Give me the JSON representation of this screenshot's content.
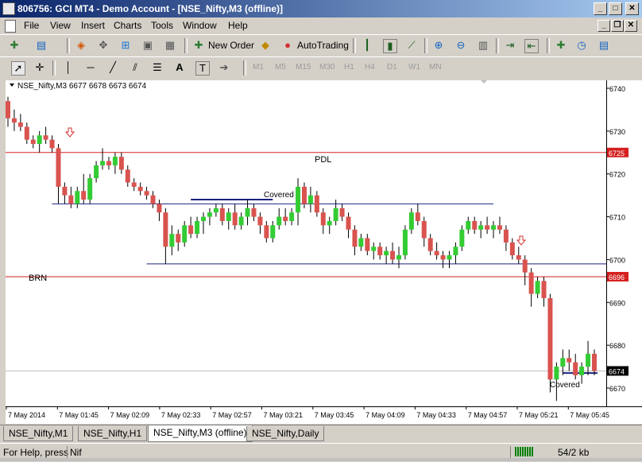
{
  "window": {
    "title": "806756: GCI MT4 - Demo Account - [NSE_Nifty,M3 (offline)]",
    "min_glyph": "_",
    "max_glyph": "□",
    "close_glyph": "✕",
    "restore_glyph": "❐"
  },
  "menu": {
    "items": [
      "File",
      "View",
      "Insert",
      "Charts",
      "Tools",
      "Window",
      "Help"
    ]
  },
  "toolbar": {
    "new_order_label": "New Order",
    "autotrading_label": "AutoTrading",
    "drawing_text_tool": "A",
    "timeframes": [
      "M1",
      "M5",
      "M15",
      "M30",
      "H1",
      "H4",
      "D1",
      "W1",
      "MN"
    ]
  },
  "chart": {
    "header": "NSE_Nifty,M3  6677 6678 6673 6674",
    "bg_color": "#ffffff",
    "bull_color": "#33cc33",
    "bear_color": "#d9534f",
    "wick_color": "#000000",
    "hline_red": "#d62020",
    "hline_blue": "#1a237e",
    "price_axis": {
      "ticks": [
        "6740",
        "6730",
        "6720",
        "6710",
        "6700",
        "6690",
        "6680",
        "6670"
      ],
      "tick_values": [
        6740,
        6730,
        6720,
        6710,
        6700,
        6690,
        6680,
        6670
      ],
      "tags": [
        {
          "value": 6725,
          "label": "6725",
          "bg": "#d62020",
          "fg": "#ffffff"
        },
        {
          "value": 6696,
          "label": "6696",
          "bg": "#d62020",
          "fg": "#ffffff"
        },
        {
          "value": 6674,
          "label": "6674",
          "bg": "#000000",
          "fg": "#ffffff"
        }
      ],
      "min": 6665,
      "max": 6742
    },
    "time_axis": {
      "labels": [
        "7 May 2014",
        "7 May 01:45",
        "7 May 02:09",
        "7 May 02:33",
        "7 May 02:57",
        "7 May 03:21",
        "7 May 03:45",
        "7 May 04:09",
        "7 May 04:33",
        "7 May 04:57",
        "7 May 05:21",
        "7 May 05:45"
      ]
    },
    "annotations": {
      "pdl": "PDL",
      "brn": "BRN",
      "covered_1": "Covered",
      "covered_2": "Covered"
    },
    "levels": {
      "pdl": 6725,
      "brn": 6696,
      "support_upper": 6713,
      "support_lower": 6699,
      "covered_1": 6714,
      "covered_2": 6673.5,
      "last_price": 6674
    },
    "candles": [
      [
        6737,
        6738,
        6731,
        6733
      ],
      [
        6733,
        6735,
        6730,
        6732
      ],
      [
        6732,
        6734,
        6730,
        6731
      ],
      [
        6731,
        6732,
        6727,
        6728
      ],
      [
        6728,
        6729,
        6726,
        6727
      ],
      [
        6727,
        6730,
        6725,
        6729
      ],
      [
        6729,
        6731,
        6727,
        6728
      ],
      [
        6728,
        6729,
        6725,
        6726
      ],
      [
        6726,
        6727,
        6713,
        6717
      ],
      [
        6717,
        6718,
        6713,
        6715
      ],
      [
        6715,
        6717,
        6712,
        6713
      ],
      [
        6713,
        6717,
        6712,
        6716
      ],
      [
        6716,
        6720,
        6713,
        6714
      ],
      [
        6714,
        6720,
        6713,
        6719
      ],
      [
        6719,
        6723,
        6718,
        6722
      ],
      [
        6722,
        6726,
        6721,
        6723
      ],
      [
        6723,
        6724,
        6721,
        6722
      ],
      [
        6722,
        6725,
        6720,
        6724
      ],
      [
        6724,
        6725,
        6720,
        6721
      ],
      [
        6721,
        6722,
        6717,
        6718
      ],
      [
        6718,
        6719,
        6716,
        6717
      ],
      [
        6717,
        6718,
        6715,
        6716
      ],
      [
        6716,
        6717,
        6714,
        6715
      ],
      [
        6715,
        6716,
        6712,
        6713
      ],
      [
        6713,
        6714,
        6709,
        6711
      ],
      [
        6711,
        6712,
        6699,
        6703
      ],
      [
        6703,
        6708,
        6701,
        6706
      ],
      [
        6706,
        6707,
        6702,
        6704
      ],
      [
        6704,
        6709,
        6703,
        6708
      ],
      [
        6708,
        6710,
        6705,
        6706
      ],
      [
        6706,
        6710,
        6705,
        6709
      ],
      [
        6709,
        6711,
        6706,
        6710
      ],
      [
        6710,
        6712,
        6708,
        6711
      ],
      [
        6711,
        6713,
        6710,
        6712
      ],
      [
        6712,
        6713,
        6708,
        6709
      ],
      [
        6709,
        6712,
        6707,
        6711
      ],
      [
        6711,
        6713,
        6707,
        6708
      ],
      [
        6708,
        6711,
        6707,
        6710
      ],
      [
        6710,
        6714,
        6708,
        6712
      ],
      [
        6712,
        6713,
        6709,
        6710
      ],
      [
        6710,
        6711,
        6706,
        6708
      ],
      [
        6708,
        6709,
        6704,
        6705
      ],
      [
        6705,
        6709,
        6704,
        6708
      ],
      [
        6708,
        6712,
        6707,
        6710
      ],
      [
        6710,
        6712,
        6708,
        6709
      ],
      [
        6709,
        6712,
        6708,
        6711
      ],
      [
        6711,
        6719,
        6708,
        6717
      ],
      [
        6717,
        6718,
        6712,
        6713
      ],
      [
        6713,
        6717,
        6711,
        6715
      ],
      [
        6715,
        6716,
        6710,
        6711
      ],
      [
        6711,
        6712,
        6706,
        6708
      ],
      [
        6708,
        6710,
        6706,
        6709
      ],
      [
        6709,
        6714,
        6708,
        6712
      ],
      [
        6712,
        6713,
        6709,
        6710
      ],
      [
        6710,
        6711,
        6705,
        6707
      ],
      [
        6707,
        6708,
        6701,
        6703
      ],
      [
        6703,
        6706,
        6702,
        6705
      ],
      [
        6705,
        6706,
        6701,
        6702
      ],
      [
        6702,
        6704,
        6700,
        6703
      ],
      [
        6703,
        6704,
        6700,
        6701
      ],
      [
        6701,
        6703,
        6699,
        6702
      ],
      [
        6702,
        6704,
        6699,
        6700
      ],
      [
        6700,
        6703,
        6698,
        6701
      ],
      [
        6701,
        6708,
        6700,
        6707
      ],
      [
        6707,
        6712,
        6706,
        6711
      ],
      [
        6711,
        6713,
        6708,
        6709
      ],
      [
        6709,
        6710,
        6703,
        6705
      ],
      [
        6705,
        6706,
        6701,
        6702
      ],
      [
        6702,
        6704,
        6700,
        6701
      ],
      [
        6701,
        6702,
        6698,
        6700
      ],
      [
        6700,
        6702,
        6698,
        6701
      ],
      [
        6701,
        6704,
        6699,
        6703
      ],
      [
        6703,
        6708,
        6702,
        6707
      ],
      [
        6707,
        6710,
        6706,
        6709
      ],
      [
        6709,
        6710,
        6706,
        6707
      ],
      [
        6707,
        6709,
        6705,
        6708
      ],
      [
        6708,
        6710,
        6706,
        6707
      ],
      [
        6707,
        6709,
        6705,
        6708
      ],
      [
        6708,
        6710,
        6706,
        6707
      ],
      [
        6707,
        6708,
        6702,
        6704
      ],
      [
        6704,
        6705,
        6700,
        6701
      ],
      [
        6701,
        6703,
        6699,
        6700
      ],
      [
        6700,
        6701,
        6694,
        6697
      ],
      [
        6697,
        6698,
        6689,
        6692
      ],
      [
        6692,
        6696,
        6691,
        6695
      ],
      [
        6695,
        6696,
        6689,
        6691
      ],
      [
        6691,
        6692,
        6669,
        6672
      ],
      [
        6672,
        6676,
        6667,
        6675
      ],
      [
        6675,
        6679,
        6673,
        6677
      ],
      [
        6677,
        6679,
        6674,
        6676
      ],
      [
        6676,
        6678,
        6672,
        6673
      ],
      [
        6673,
        6676,
        6671,
        6675
      ],
      [
        6675,
        6681,
        6673,
        6678
      ],
      [
        6678,
        6679,
        6673,
        6674
      ]
    ]
  },
  "tabs": [
    "NSE_Nifty,M1",
    "NSE_Nifty,H1",
    "NSE_Nifty,M3 (offline)",
    "NSE_Nifty,Daily"
  ],
  "active_tab": 2,
  "status": {
    "help": "For Help, press",
    "symbol": "Nif",
    "traffic": "54/2 kb"
  }
}
